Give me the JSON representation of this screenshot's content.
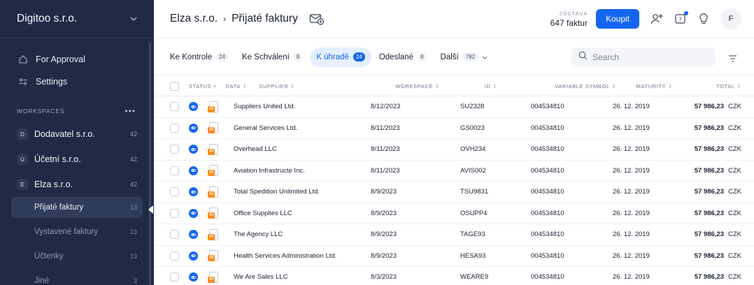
{
  "org": {
    "name": "Digitoo s.r.o."
  },
  "nav": [
    {
      "label": "For Approval",
      "icon": "home-icon"
    },
    {
      "label": "Settings",
      "icon": "settings-icon"
    }
  ],
  "workspaces": {
    "heading": "WORKSPACES",
    "more": "•••",
    "items": [
      {
        "letter": "D",
        "name": "Dodavatel s.r.o.",
        "count": "42"
      },
      {
        "letter": "Ú",
        "name": "Účetní s.r.o.",
        "count": "42"
      },
      {
        "letter": "E",
        "name": "Elza s.r.o.",
        "count": "42"
      }
    ],
    "subitems": [
      {
        "name": "Přijaté faktury",
        "count": "13",
        "active": true
      },
      {
        "name": "Vystavené faktury",
        "count": "13"
      },
      {
        "name": "Účtenky",
        "count": "13"
      },
      {
        "name": "Jiné",
        "count": "3"
      }
    ]
  },
  "header": {
    "workspace": "Elza s.r.o.",
    "separator": "›",
    "page": "Přijaté faktury",
    "remain_label": "ZŮSTÁVÁ",
    "remain_value": "647 faktur",
    "buy_label": "Koupit",
    "avatar": "F"
  },
  "tabs": [
    {
      "label": "Ke Kontrole",
      "count": "24"
    },
    {
      "label": "Ke Schválení",
      "count": "8"
    },
    {
      "label": "K úhradě",
      "count": "24",
      "active": true
    },
    {
      "label": "Odeslané",
      "count": "8"
    },
    {
      "label": "Další",
      "count": "782"
    }
  ],
  "search": {
    "placeholder": "Search"
  },
  "columns": {
    "status": "STATUS",
    "data": "DATA",
    "supplier": "SUPPLIER",
    "workspace": "WORKSPACE",
    "id": "ID",
    "vs": "VARIABLE SYMBOL",
    "maturity": "MATURITY",
    "total": "TOTAL"
  },
  "rows": [
    {
      "supplier": "Suppliers United Ltd.",
      "date": "8/12/2023",
      "id": "SU2328",
      "vs": "004534810",
      "maturity": "26. 12. 2019",
      "total": "57 986,23",
      "currency": "CZK"
    },
    {
      "supplier": "General Services Ltd.",
      "date": "8/11/2023",
      "id": "GS0023",
      "vs": "004534810",
      "maturity": "26. 12. 2019",
      "total": "57 986,23",
      "currency": "CZK"
    },
    {
      "supplier": "Overhead LLC",
      "date": "8/11/2023",
      "id": "OVH234",
      "vs": "004534810",
      "maturity": "26. 12. 2019",
      "total": "57 986,23",
      "currency": "CZK"
    },
    {
      "supplier": "Aviation Infrastructe Inc.",
      "date": "8/11/2023",
      "id": "AVIS002",
      "vs": "004534810",
      "maturity": "26. 12. 2019",
      "total": "57 986,23",
      "currency": "CZK"
    },
    {
      "supplier": "Total Spedition Unlimited Ltd.",
      "date": "8/9/2023",
      "id": "TSU9831",
      "vs": "004534810",
      "maturity": "26. 12. 2019",
      "total": "57 986,23",
      "currency": "CZK"
    },
    {
      "supplier": "Office Supplies LLC",
      "date": "8/9/2023",
      "id": "OSUPP4",
      "vs": "004534810",
      "maturity": "26. 12. 2019",
      "total": "57 986,23",
      "currency": "CZK"
    },
    {
      "supplier": "The Agency LLC",
      "date": "8/9/2023",
      "id": "TAGE93",
      "vs": "004534810",
      "maturity": "26. 12. 2019",
      "total": "57 986,23",
      "currency": "CZK"
    },
    {
      "supplier": "Health Services Administration Ltd.",
      "date": "8/9/2023",
      "id": "HESA93",
      "vs": "004534810",
      "maturity": "26. 12. 2019",
      "total": "57 986,23",
      "currency": "CZK"
    },
    {
      "supplier": "We Are Sales LLC",
      "date": "8/3/2023",
      "id": "WEARE9",
      "vs": "004534810",
      "maturity": "26. 12. 2019",
      "total": "57 986,23",
      "currency": "CZK"
    }
  ],
  "ai_badge": "AI",
  "colors": {
    "accent": "#1466f0",
    "sidebar": "#1f2b45",
    "ai": "#ff8a1f"
  }
}
